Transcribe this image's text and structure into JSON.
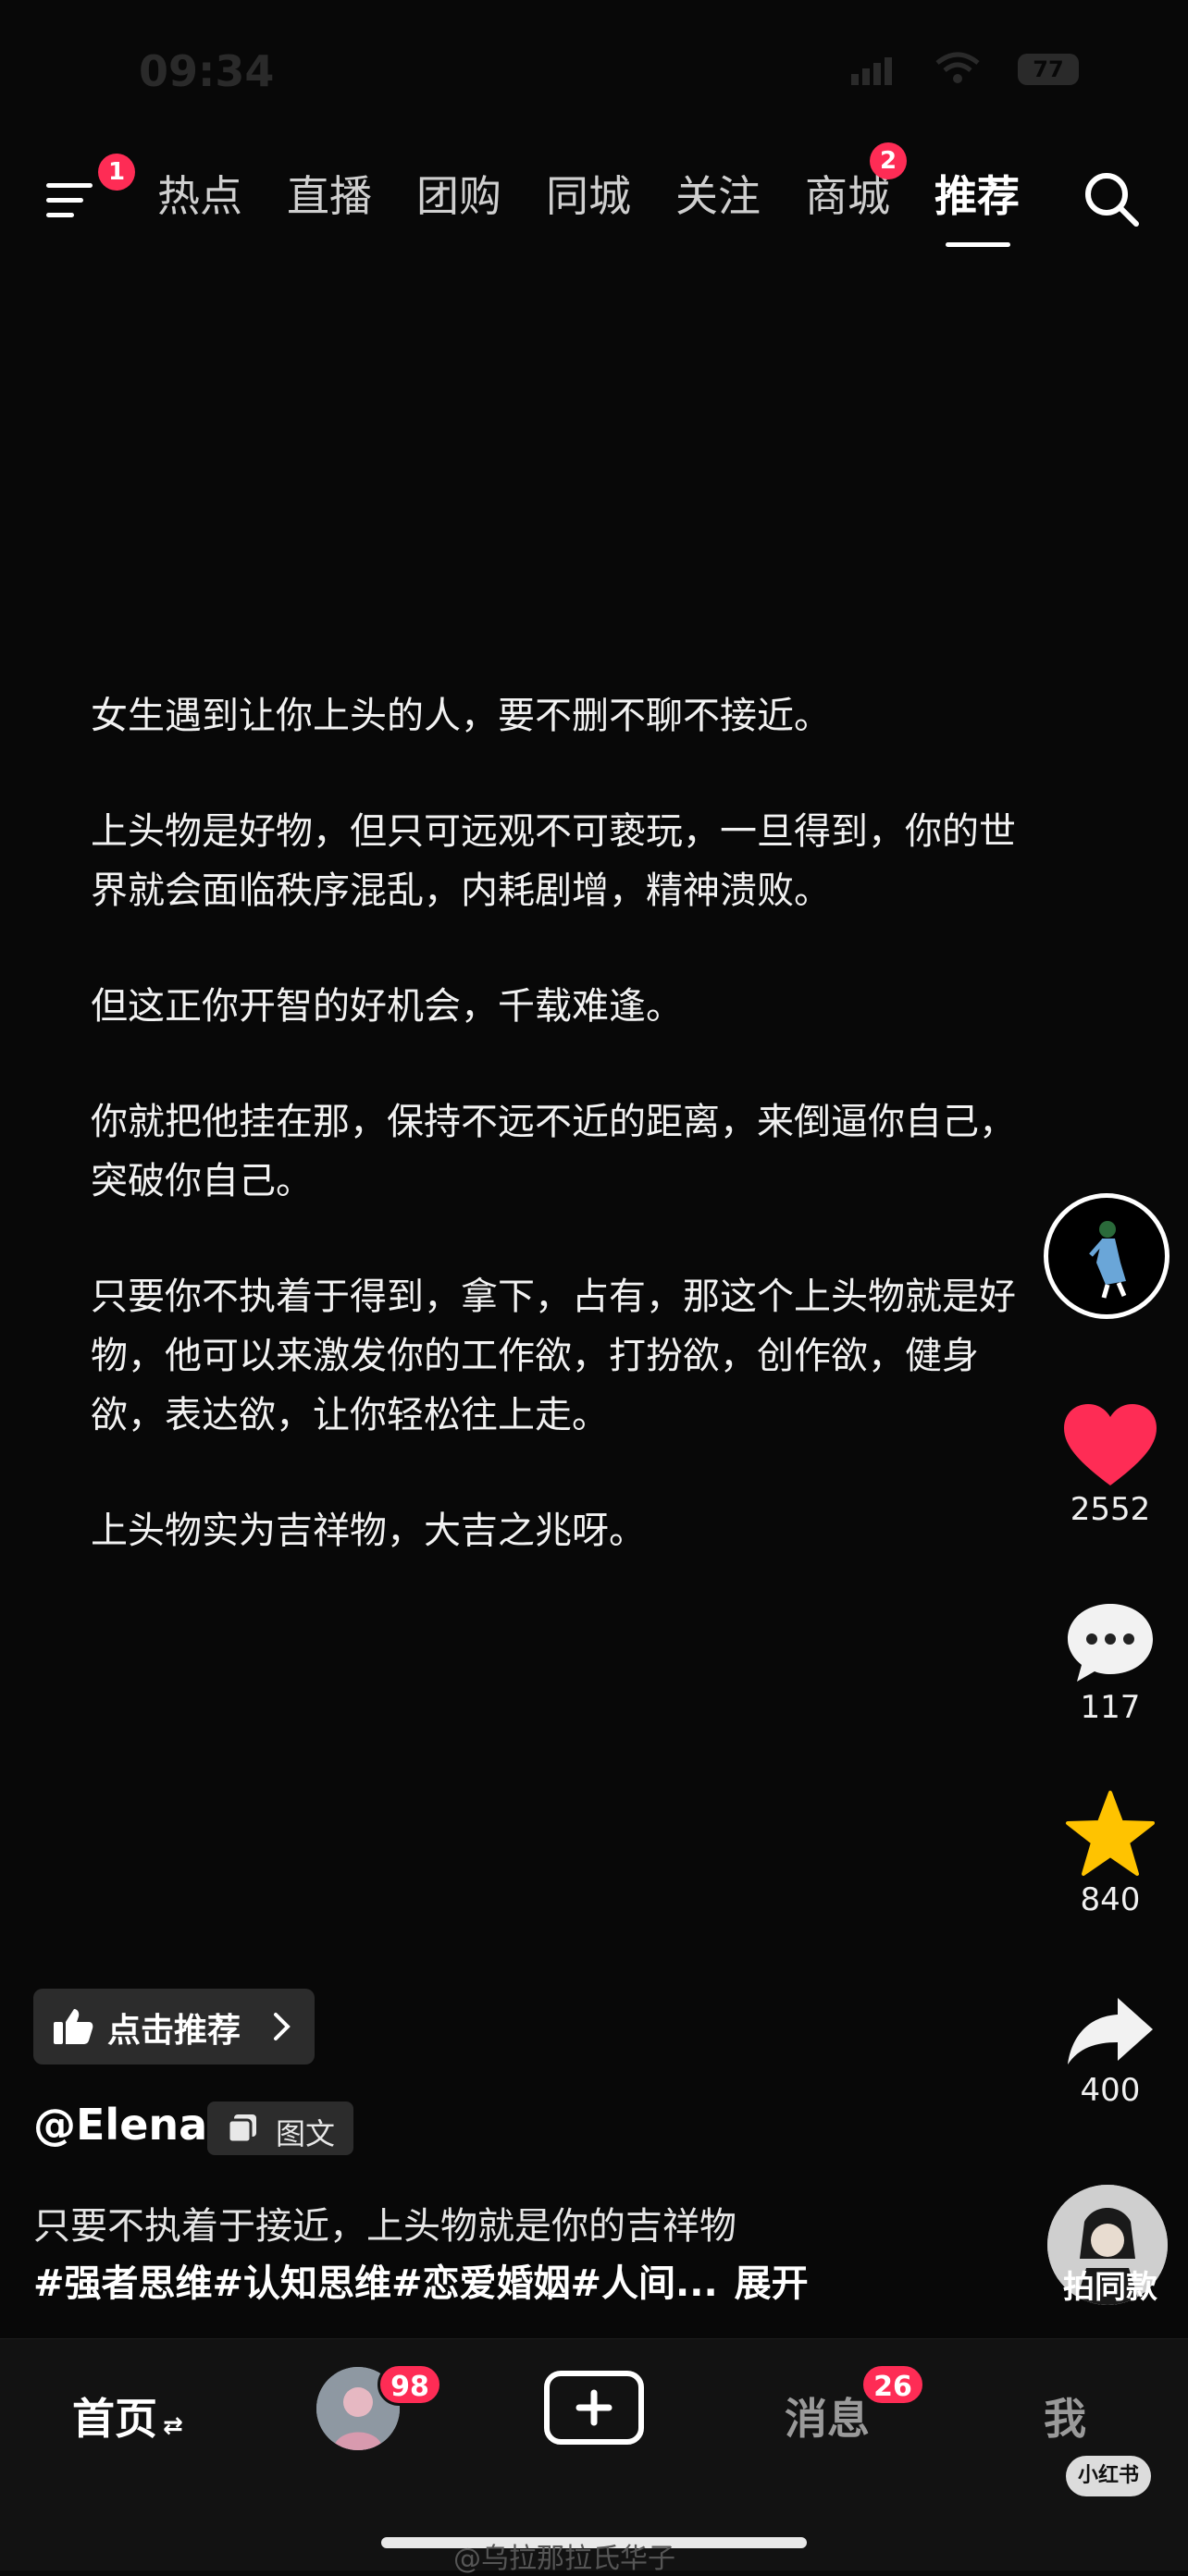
{
  "status_bar": {
    "time": "09:34",
    "battery": "77"
  },
  "top_nav": {
    "menu_badge": "1",
    "tabs": [
      {
        "label": "热点"
      },
      {
        "label": "直播"
      },
      {
        "label": "团购"
      },
      {
        "label": "同城"
      },
      {
        "label": "关注"
      },
      {
        "label": "商城",
        "badge": "2"
      },
      {
        "label": "推荐"
      }
    ],
    "active_tab": "推荐"
  },
  "post": {
    "paragraphs": [
      "女生遇到让你上头的人，要不删不聊不接近。",
      "上头物是好物，但只可远观不可亵玩，一旦得到，你的世界就会面临秩序混乱，内耗剧增，精神溃败。",
      "但这正你开智的好机会，千载难逢。",
      "你就把他挂在那，保持不远不近的距离，来倒逼你自己，突破你自己。",
      "只要你不执着于得到，拿下，占有，那这个上头物就是好物，他可以来激发你的工作欲，打扮欲，创作欲，健身欲，表达欲，让你轻松往上走。",
      "上头物实为吉祥物，大吉之兆呀。"
    ],
    "recommend_label": "点击推荐",
    "author": "@Elena",
    "type_tag": "图文",
    "description": "只要不执着于接近，上头物就是你的吉祥物",
    "hashtags": "#强者思维#认知思维#恋爱婚姻#人间...",
    "expand_label": "展开"
  },
  "actions": {
    "likes": "2552",
    "comments": "117",
    "favorites": "840",
    "shares": "400",
    "music_label": "拍同款"
  },
  "bottom_nav": {
    "home": "首页",
    "home_swap": "⇄",
    "friends_badge": "98",
    "add": "+",
    "messages": "消息",
    "messages_badge": "26",
    "me": "我"
  },
  "watermark": {
    "badge": "小红书",
    "credit": "@乌拉那拉氏华子"
  },
  "colors": {
    "accent": "#fe2c55",
    "like": "#fe2c55",
    "favorite": "#ffc300",
    "background": "#080808"
  }
}
